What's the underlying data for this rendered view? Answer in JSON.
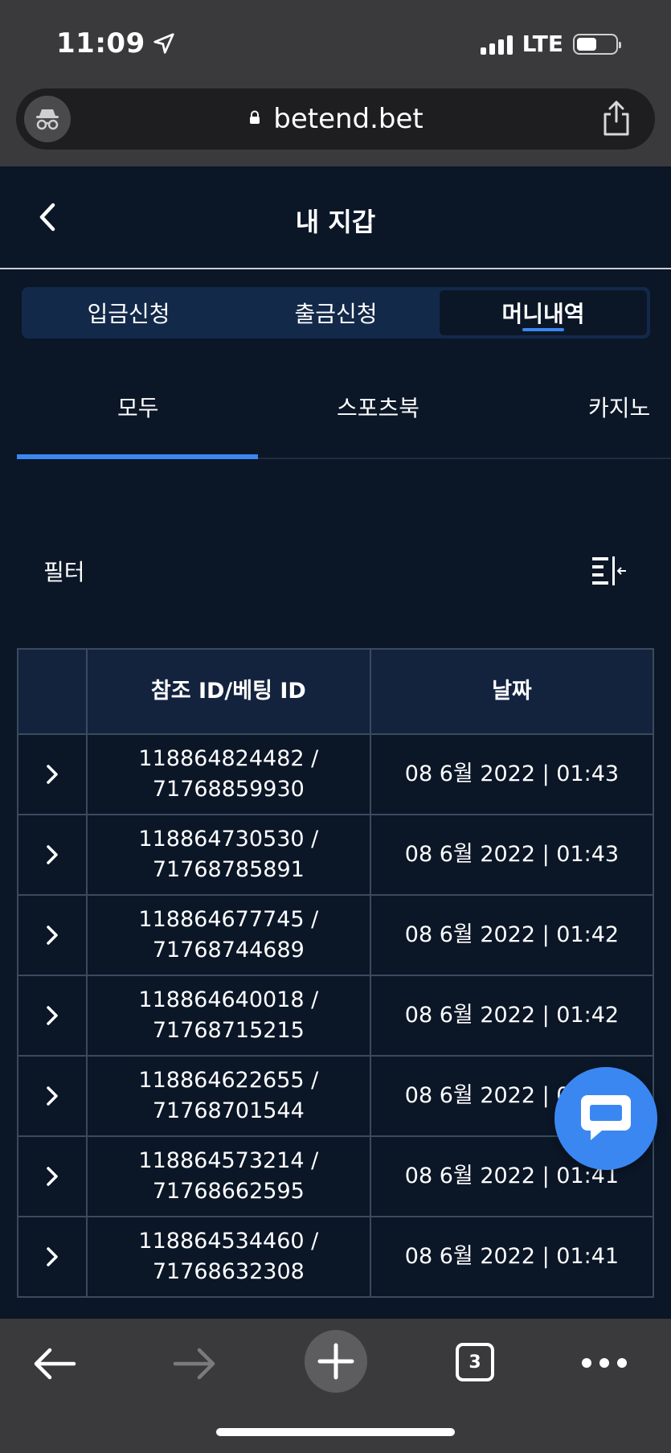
{
  "status_bar": {
    "time": "11:09",
    "network": "LTE"
  },
  "browser": {
    "url": "betend.bet",
    "tab_count": "3"
  },
  "header": {
    "title": "내 지갑"
  },
  "segments": [
    {
      "label": "입금신청",
      "active": false
    },
    {
      "label": "출금신청",
      "active": false
    },
    {
      "label": "머니내역",
      "active": true
    }
  ],
  "subtabs": [
    {
      "label": "모두",
      "active": true
    },
    {
      "label": "스포츠북",
      "active": false
    },
    {
      "label": "카지노",
      "active": false
    }
  ],
  "filter": {
    "label": "필터"
  },
  "table": {
    "headers": [
      "",
      "참조 ID/베팅 ID",
      "날짜"
    ],
    "rows": [
      {
        "ref_id": "118864824482 /",
        "bet_id": "71768859930",
        "date": "08 6월 2022 | 01:43"
      },
      {
        "ref_id": "118864730530 /",
        "bet_id": "71768785891",
        "date": "08 6월 2022 | 01:43"
      },
      {
        "ref_id": "118864677745 /",
        "bet_id": "71768744689",
        "date": "08 6월 2022 | 01:42"
      },
      {
        "ref_id": "118864640018 /",
        "bet_id": "71768715215",
        "date": "08 6월 2022 | 01:42"
      },
      {
        "ref_id": "118864622655 /",
        "bet_id": "71768701544",
        "date": "08 6월 2022 | 01:42"
      },
      {
        "ref_id": "118864573214 /",
        "bet_id": "71768662595",
        "date": "08 6월 2022 | 01:41"
      },
      {
        "ref_id": "118864534460 /",
        "bet_id": "71768632308",
        "date": "08 6월 2022 | 01:41"
      }
    ]
  },
  "colors": {
    "background": "#0b1627",
    "accent": "#3a87f2",
    "segment_bg": "#13294a",
    "table_header_bg": "#13233e"
  }
}
